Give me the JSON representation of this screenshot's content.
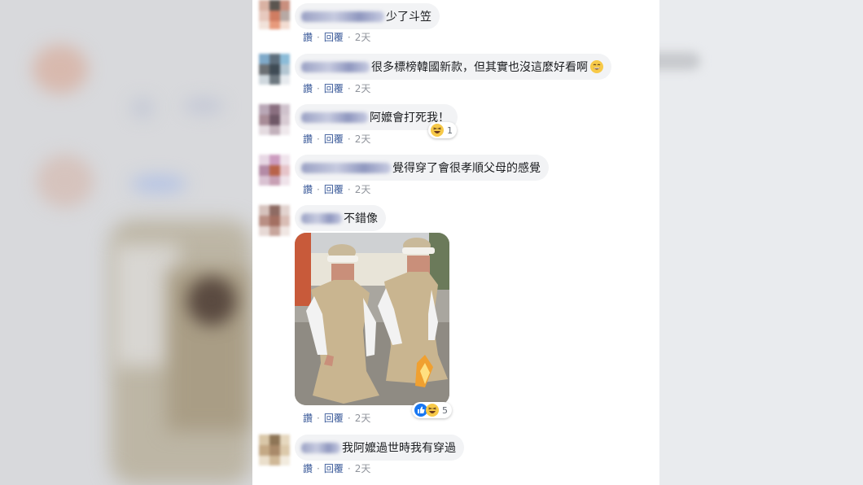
{
  "action_labels": {
    "like": "讚",
    "reply": "回覆"
  },
  "comments": [
    {
      "text": "少了斗笠",
      "time": "2天"
    },
    {
      "text": "很多標榜韓國新款，但其實也沒這麼好看啊",
      "time": "2天"
    },
    {
      "text": "阿嬤會打死我！",
      "time": "2天",
      "reaction_count": "1"
    },
    {
      "text": "覺得穿了會很孝順父母的感覺",
      "time": "2天"
    },
    {
      "text": "不錯像",
      "time": "2天",
      "reaction_count": "5"
    },
    {
      "text": "我阿嬤過世時我有穿過",
      "time": "2天"
    }
  ],
  "icons": [
    "grin-emoji-icon",
    "haha-reaction-icon",
    "like-reaction-icon"
  ],
  "colors": {
    "link": "#385898",
    "bubble": "#f2f3f5",
    "meta": "#90949c"
  }
}
